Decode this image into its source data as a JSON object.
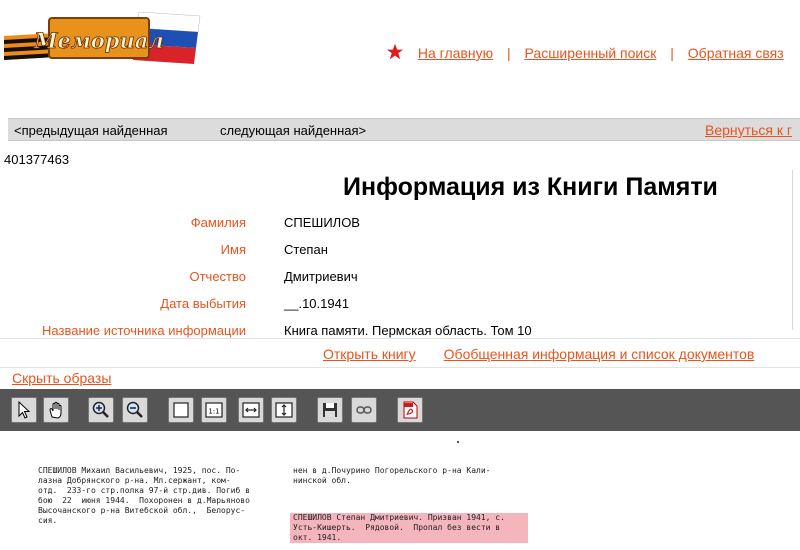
{
  "header": {
    "logo_text": "Мемориал",
    "nav": {
      "home": "На главную",
      "sep1": "|",
      "advanced_search": "Расширенный поиск",
      "sep2": "|",
      "feedback": "Обратная связ"
    }
  },
  "navbar": {
    "prev": "<предыдущая найденная",
    "next": "следующая найденная>",
    "back": "Вернуться к г"
  },
  "record_id": "401377463",
  "page_title": "Информация из Книги Памяти",
  "fields": [
    {
      "label": "Фамилия",
      "value": "СПЕШИЛОВ"
    },
    {
      "label": "Имя",
      "value": "Степан"
    },
    {
      "label": "Отчество",
      "value": "Дмитриевич"
    },
    {
      "label": "Дата выбытия",
      "value": "__.10.1941"
    },
    {
      "label": "Название источника информации",
      "value": "Книга памяти. Пермская область. Том 10"
    }
  ],
  "links": {
    "open_book": "Открыть книгу",
    "summary": "Обобщенная информация и список документов"
  },
  "hide_images": "Скрыть образы",
  "toolbar_icons": [
    "pointer-tool-icon",
    "hand-tool-icon",
    "zoom-in-icon",
    "zoom-out-icon",
    "fit-page-icon",
    "actual-size-icon",
    "fit-width-icon",
    "fit-height-icon",
    "save-icon",
    "link-icon",
    "pdf-icon"
  ],
  "scan": {
    "col1": "СПЕШИЛОВ Михаил Васильевич, 1925, пос. По-\nлазна Добрянского р-на. Мл.сержант, ком-\nотд.  233-го стр.полка 97-й стр.див. Погиб в\nбою  22  июня 1944.  Похоронен в д.Марьяново\nВысочанского р-на Витебской обл.,  Белорус-\nсия.",
    "col2": "нен в д.Почурино Погорельского р-на Кали-\nнинской обл.",
    "col2_highlight": "СПЕШИЛОВ Степан Дмитриевич. Призван 1941, с.\nУсть-Кишерть.  Рядовой.  Пропал без вести в\nокт. 1941."
  },
  "colors": {
    "accent": "#e8541c",
    "toolbar_bg": "#555555",
    "navbar_bg": "#dcdcdc",
    "highlight": "#f5b5bd"
  }
}
